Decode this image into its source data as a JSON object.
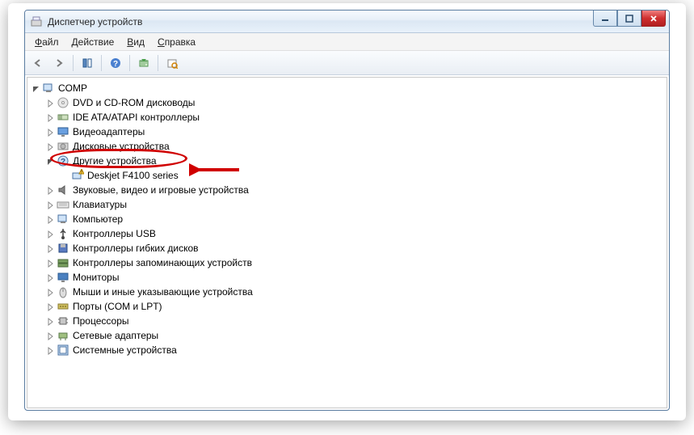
{
  "window": {
    "title": "Диспетчер устройств"
  },
  "menu": {
    "file": {
      "label_pre": "",
      "ul": "Ф",
      "label_post": "айл"
    },
    "action": {
      "label_pre": "",
      "ul": "Д",
      "label_post": "ействие"
    },
    "view": {
      "label_pre": "",
      "ul": "В",
      "label_post": "ид"
    },
    "help": {
      "label_pre": "",
      "ul": "С",
      "label_post": "правка"
    }
  },
  "tree": {
    "root": "COMP",
    "nodes": [
      {
        "label": "DVD и CD-ROM дисководы",
        "icon": "disc"
      },
      {
        "label": "IDE ATA/ATAPI контроллеры",
        "icon": "ide"
      },
      {
        "label": "Видеоадаптеры",
        "icon": "display"
      },
      {
        "label": "Дисковые устройства",
        "icon": "hdd"
      },
      {
        "label": "Другие устройства",
        "icon": "unknown",
        "expanded": true,
        "children": [
          {
            "label": "Deskjet F4100 series",
            "icon": "warn"
          }
        ]
      },
      {
        "label": "Звуковые, видео и игровые устройства",
        "icon": "audio"
      },
      {
        "label": "Клавиатуры",
        "icon": "keyboard"
      },
      {
        "label": "Компьютер",
        "icon": "computer"
      },
      {
        "label": "Контроллеры USB",
        "icon": "usb"
      },
      {
        "label": "Контроллеры гибких дисков",
        "icon": "floppy"
      },
      {
        "label": "Контроллеры запоминающих устройств",
        "icon": "storage"
      },
      {
        "label": "Мониторы",
        "icon": "monitor"
      },
      {
        "label": "Мыши и иные указывающие устройства",
        "icon": "mouse"
      },
      {
        "label": "Порты (COM и LPT)",
        "icon": "ports"
      },
      {
        "label": "Процессоры",
        "icon": "cpu"
      },
      {
        "label": "Сетевые адаптеры",
        "icon": "network"
      },
      {
        "label": "Системные устройства",
        "icon": "system"
      }
    ]
  }
}
